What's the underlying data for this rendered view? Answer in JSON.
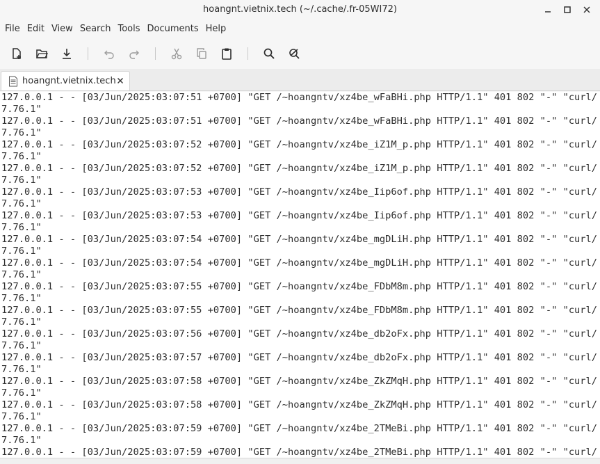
{
  "window": {
    "title": "hoangnt.vietnix.tech (~/.cache/.fr-05WI72)"
  },
  "menu": [
    "File",
    "Edit",
    "View",
    "Search",
    "Tools",
    "Documents",
    "Help"
  ],
  "tab": {
    "label": "hoangnt.vietnix.tech"
  },
  "editor": {
    "lines": [
      "127.0.0.1 - - [03/Jun/2025:03:07:51 +0700] \"GET /~hoangntv/xz4be_wFaBHi.php HTTP/1.1\" 401 802 \"-\" \"curl/",
      "7.76.1\"",
      "127.0.0.1 - - [03/Jun/2025:03:07:51 +0700] \"GET /~hoangntv/xz4be_wFaBHi.php HTTP/1.1\" 401 802 \"-\" \"curl/",
      "7.76.1\"",
      "127.0.0.1 - - [03/Jun/2025:03:07:52 +0700] \"GET /~hoangntv/xz4be_iZ1M_p.php HTTP/1.1\" 401 802 \"-\" \"curl/",
      "7.76.1\"",
      "127.0.0.1 - - [03/Jun/2025:03:07:52 +0700] \"GET /~hoangntv/xz4be_iZ1M_p.php HTTP/1.1\" 401 802 \"-\" \"curl/",
      "7.76.1\"",
      "127.0.0.1 - - [03/Jun/2025:03:07:53 +0700] \"GET /~hoangntv/xz4be_Iip6of.php HTTP/1.1\" 401 802 \"-\" \"curl/",
      "7.76.1\"",
      "127.0.0.1 - - [03/Jun/2025:03:07:53 +0700] \"GET /~hoangntv/xz4be_Iip6of.php HTTP/1.1\" 401 802 \"-\" \"curl/",
      "7.76.1\"",
      "127.0.0.1 - - [03/Jun/2025:03:07:54 +0700] \"GET /~hoangntv/xz4be_mgDLiH.php HTTP/1.1\" 401 802 \"-\" \"curl/",
      "7.76.1\"",
      "127.0.0.1 - - [03/Jun/2025:03:07:54 +0700] \"GET /~hoangntv/xz4be_mgDLiH.php HTTP/1.1\" 401 802 \"-\" \"curl/",
      "7.76.1\"",
      "127.0.0.1 - - [03/Jun/2025:03:07:55 +0700] \"GET /~hoangntv/xz4be_FDbM8m.php HTTP/1.1\" 401 802 \"-\" \"curl/",
      "7.76.1\"",
      "127.0.0.1 - - [03/Jun/2025:03:07:55 +0700] \"GET /~hoangntv/xz4be_FDbM8m.php HTTP/1.1\" 401 802 \"-\" \"curl/",
      "7.76.1\"",
      "127.0.0.1 - - [03/Jun/2025:03:07:56 +0700] \"GET /~hoangntv/xz4be_db2oFx.php HTTP/1.1\" 401 802 \"-\" \"curl/",
      "7.76.1\"",
      "127.0.0.1 - - [03/Jun/2025:03:07:57 +0700] \"GET /~hoangntv/xz4be_db2oFx.php HTTP/1.1\" 401 802 \"-\" \"curl/",
      "7.76.1\"",
      "127.0.0.1 - - [03/Jun/2025:03:07:58 +0700] \"GET /~hoangntv/xz4be_ZkZMqH.php HTTP/1.1\" 401 802 \"-\" \"curl/",
      "7.76.1\"",
      "127.0.0.1 - - [03/Jun/2025:03:07:58 +0700] \"GET /~hoangntv/xz4be_ZkZMqH.php HTTP/1.1\" 401 802 \"-\" \"curl/",
      "7.76.1\"",
      "127.0.0.1 - - [03/Jun/2025:03:07:59 +0700] \"GET /~hoangntv/xz4be_2TMeBi.php HTTP/1.1\" 401 802 \"-\" \"curl/",
      "7.76.1\"",
      "127.0.0.1 - - [03/Jun/2025:03:07:59 +0700] \"GET /~hoangntv/xz4be_2TMeBi.php HTTP/1.1\" 401 802 \"-\" \"curl/"
    ]
  }
}
